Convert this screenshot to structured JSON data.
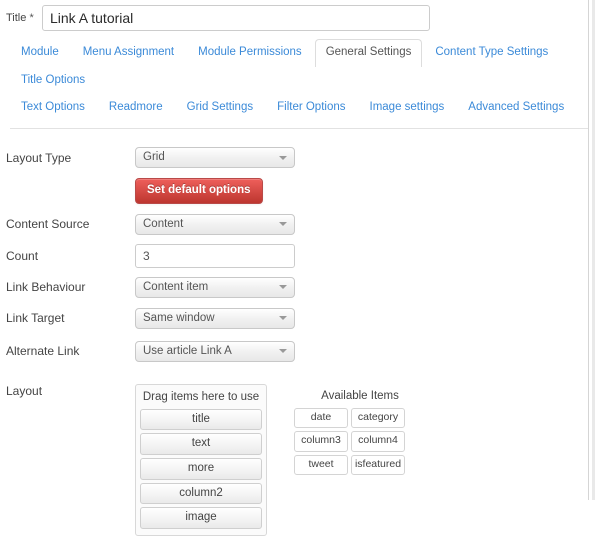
{
  "title_field": {
    "label": "Title",
    "required_mark": "*",
    "value": "Link A tutorial",
    "placeholder": "Title"
  },
  "tabs": {
    "row1": [
      {
        "label": "Module",
        "active": false
      },
      {
        "label": "Menu Assignment",
        "active": false
      },
      {
        "label": "Module Permissions",
        "active": false
      },
      {
        "label": "General Settings",
        "active": true
      },
      {
        "label": "Content Type Settings",
        "active": false
      },
      {
        "label": "Title Options",
        "active": false
      }
    ],
    "row2": [
      {
        "label": "Text Options",
        "active": false
      },
      {
        "label": "Readmore",
        "active": false
      },
      {
        "label": "Grid Settings",
        "active": false
      },
      {
        "label": "Filter Options",
        "active": false
      },
      {
        "label": "Image settings",
        "active": false
      },
      {
        "label": "Advanced Settings",
        "active": false
      }
    ]
  },
  "form": {
    "layout_type": {
      "label": "Layout Type",
      "value": "Grid"
    },
    "set_default_button": {
      "label": "Set default options"
    },
    "content_source": {
      "label": "Content Source",
      "value": "Content"
    },
    "count": {
      "label": "Count",
      "value": "3",
      "placeholder": ""
    },
    "link_behaviour": {
      "label": "Link Behaviour",
      "value": "Content item"
    },
    "link_target": {
      "label": "Link Target",
      "value": "Same window"
    },
    "alternate_link": {
      "label": "Alternate Link",
      "value": "Use article Link A"
    },
    "layout": {
      "label": "Layout",
      "drop_zone_title": "Drag items here to use",
      "used_items": [
        "title",
        "text",
        "more",
        "column2",
        "image"
      ],
      "available_title": "Available Items",
      "available_items": [
        "date",
        "category",
        "column3",
        "column4",
        "tweet",
        "isfeatured"
      ]
    }
  },
  "colors": {
    "tab_link": "#3b8ad8",
    "tab_active_text": "#555555",
    "danger_button": "#bd362f",
    "label_text": "#444444"
  }
}
